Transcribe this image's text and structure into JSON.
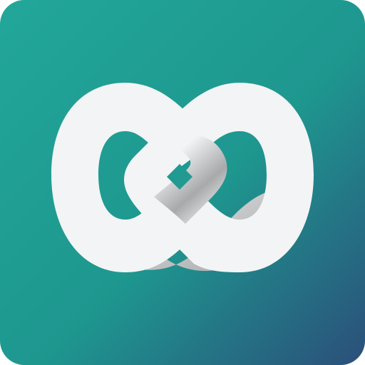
{
  "app_icon": {
    "name": "infinity-loop-logo",
    "icon": "infinity-loop-icon",
    "colors": {
      "background_top_left": "#22A79A",
      "background_mid": "#1E978F",
      "background_bottom_right": "#2B4F7A",
      "loop_front": "#F3F4F5",
      "loop_shadow_light": "#E6E7E8",
      "loop_shadow_dark": "#A8A9AB",
      "hole_color": "#219A91"
    }
  }
}
